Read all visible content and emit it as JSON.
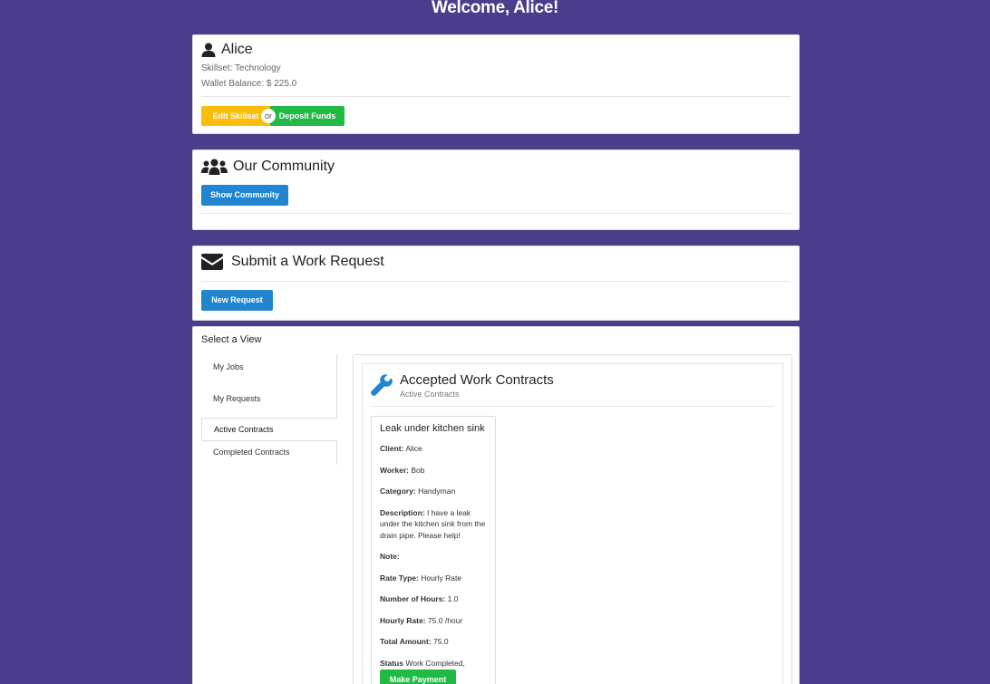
{
  "header": {
    "welcome": "Welcome, Alice!"
  },
  "profile": {
    "name": "Alice",
    "skillset": "Skillset: Technology",
    "wallet": "Wallet Balance: $ 225.0",
    "edit_label": "Edit Skillset",
    "or_label": "or",
    "deposit_label": "Deposit Funds"
  },
  "community": {
    "title": "Our Community",
    "button_label": "Show Community"
  },
  "request": {
    "title": "Submit a Work Request",
    "button_label": "New Request"
  },
  "view": {
    "title": "Select a View",
    "tabs": [
      {
        "label": "My Jobs"
      },
      {
        "label": "My Requests"
      },
      {
        "label": "Active Contracts"
      },
      {
        "label": "Completed Contracts"
      }
    ],
    "active_tab": "Active Contracts",
    "contracts": {
      "title": "Accepted Work Contracts",
      "subtitle": "Active Contracts",
      "card": {
        "title": "Leak under kitchen sink",
        "client_label": "Client:",
        "client": "Alice",
        "worker_label": "Worker:",
        "worker": "Bob",
        "category_label": "Category:",
        "category": "Handyman",
        "description_label": "Description:",
        "description": "I have a leak under the kitchen sink from the drain pipe. Please help!",
        "note_label": "Note:",
        "note": "",
        "rate_type_label": "Rate Type:",
        "rate_type": "Hourly Rate",
        "hours_label": "Number of Hours:",
        "hours": "1.0",
        "hourly_rate_label": "Hourly Rate:",
        "hourly_rate": "75.0 /hour",
        "total_label": "Total Amount:",
        "total": "75.0",
        "status_label": "Status",
        "status": "Work Completed, Awaiting Payment",
        "pay_label": "Make Payment"
      }
    }
  },
  "colors": {
    "background": "#4b3c8c",
    "yellow": "#fbbd08",
    "green": "#21ba45",
    "blue": "#2185d0"
  },
  "icons": {
    "profile": "user-icon",
    "community": "users-icon",
    "request": "envelope-icon",
    "contracts": "wrench-icon"
  }
}
